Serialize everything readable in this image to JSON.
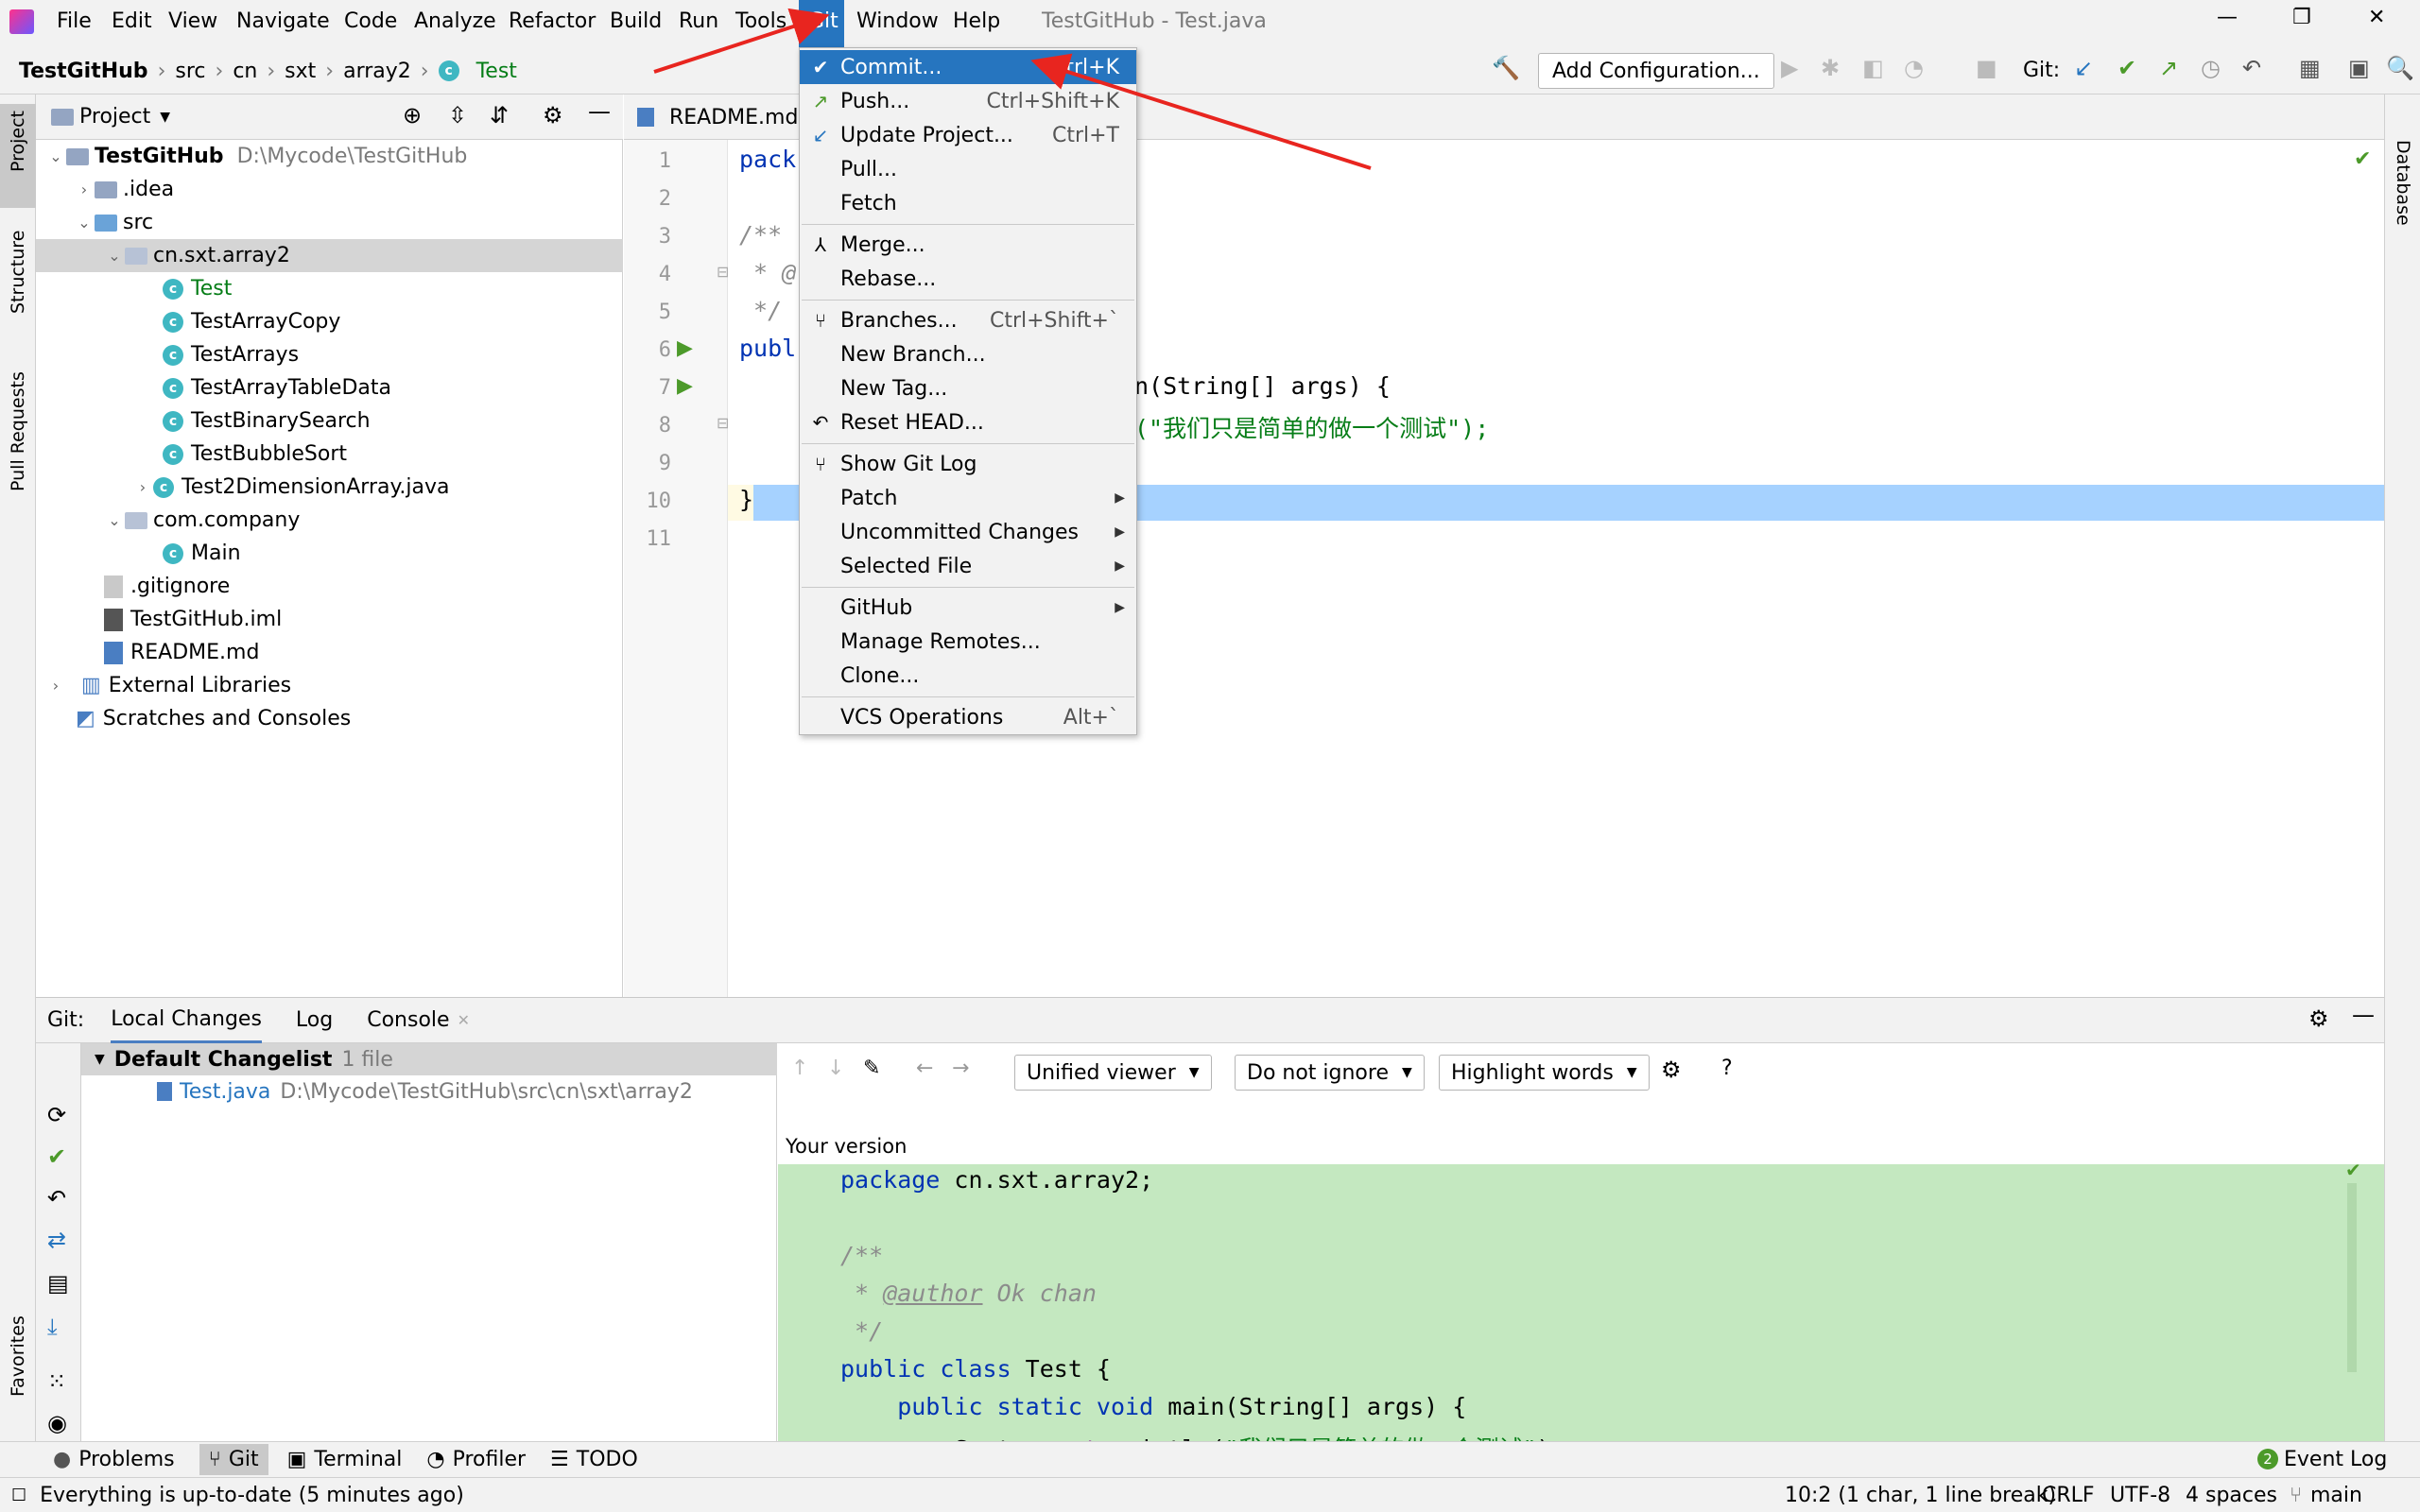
{
  "menubar": {
    "items": [
      "File",
      "Edit",
      "View",
      "Navigate",
      "Code",
      "Analyze",
      "Refactor",
      "Build",
      "Run",
      "Tools",
      "Git",
      "Window",
      "Help"
    ],
    "window_title": "TestGitHub - Test.java"
  },
  "navbar": {
    "crumbs": [
      "TestGitHub",
      "src",
      "cn",
      "sxt",
      "array2",
      "Test"
    ],
    "add_configuration": "Add Configuration...",
    "git_label": "Git:"
  },
  "left_strip": {
    "project": "Project",
    "structure": "Structure",
    "pull_requests": "Pull Requests",
    "favorites": "Favorites"
  },
  "right_strip": {
    "database": "Database"
  },
  "project": {
    "title": "Project",
    "root_name": "TestGitHub",
    "root_path": "D:\\Mycode\\TestGitHub",
    "idea": ".idea",
    "src": "src",
    "pkg1": "cn.sxt.array2",
    "classes": [
      "Test",
      "TestArrayCopy",
      "TestArrays",
      "TestArrayTableData",
      "TestBinarySearch",
      "TestBubbleSort",
      "Test2DimensionArray.java"
    ],
    "pkg2": "com.company",
    "main": "Main",
    "gitignore": ".gitignore",
    "iml": "TestGitHub.iml",
    "readme": "README.md",
    "ext_libs": "External Libraries",
    "scratches": "Scratches and Consoles"
  },
  "editor": {
    "tab": "README.md",
    "line_numbers": [
      "1",
      "2",
      "3",
      "4",
      "5",
      "6",
      "7",
      "8",
      "9",
      "10",
      "11"
    ],
    "l1": "pack",
    "l3": "/**",
    "l4": " * @",
    "l5": " */",
    "l6": "publ",
    "l7": "n(String[] args) {",
    "l8": "(\"我们只是简单的做一个测试\");",
    "l10": "}"
  },
  "git_menu": {
    "commit": {
      "label": "Commit...",
      "shortcut": "Ctrl+K"
    },
    "push": {
      "label": "Push...",
      "shortcut": "Ctrl+Shift+K"
    },
    "update": {
      "label": "Update Project...",
      "shortcut": "Ctrl+T"
    },
    "pull": "Pull...",
    "fetch": "Fetch",
    "merge": "Merge...",
    "rebase": "Rebase...",
    "branches": {
      "label": "Branches...",
      "shortcut": "Ctrl+Shift+`"
    },
    "new_branch": "New Branch...",
    "new_tag": "New Tag...",
    "reset_head": "Reset HEAD...",
    "show_git_log": "Show Git Log",
    "patch": "Patch",
    "uncommitted": "Uncommitted Changes",
    "selected_file": "Selected File",
    "github": "GitHub",
    "manage_remotes": "Manage Remotes...",
    "clone": "Clone...",
    "vcs_ops": {
      "label": "VCS Operations",
      "shortcut": "Alt+`"
    }
  },
  "git_panel": {
    "prefix": "Git:",
    "tabs": [
      "Local Changes",
      "Log",
      "Console"
    ],
    "changelist": "Default Changelist",
    "changelist_count": "1 file",
    "file_name": "Test.java",
    "file_path": "D:\\Mycode\\TestGitHub\\src\\cn\\sxt\\array2",
    "viewer": "Unified viewer",
    "ignore": "Do not ignore",
    "highlight": "Highlight words",
    "your_version": "Your version",
    "diff_lines": {
      "d1_kw": "package",
      "d1_rest": " cn.sxt.array2;",
      "d3": "/**",
      "d4a": " * ",
      "d4b": "@author",
      "d4c": " Ok chan",
      "d5": " */",
      "d6_kw": "public class",
      "d6_rest": " Test {",
      "d7_kw": "    public static void",
      "d7_rest": " main(String[] args) {",
      "d8a": "        System.",
      "d8b": "out",
      "d8c": ".println(",
      "d8d": "\"我们只是简单的做一个测试\"",
      "d8e": ");"
    }
  },
  "tool_windows": [
    "Problems",
    "Git",
    "Terminal",
    "Profiler",
    "TODO"
  ],
  "event_log": "Event Log",
  "event_count": "2",
  "status": {
    "message": "Everything is up-to-date (5 minutes ago)",
    "position": "10:2 (1 char, 1 line break)",
    "line_sep": "CRLF",
    "encoding": "UTF-8",
    "indent": "4 spaces",
    "branch": "main"
  },
  "colors": {
    "accent": "#2675bf",
    "annotation_arrow": "#e8251f",
    "diff_added": "#c4e8c0"
  }
}
